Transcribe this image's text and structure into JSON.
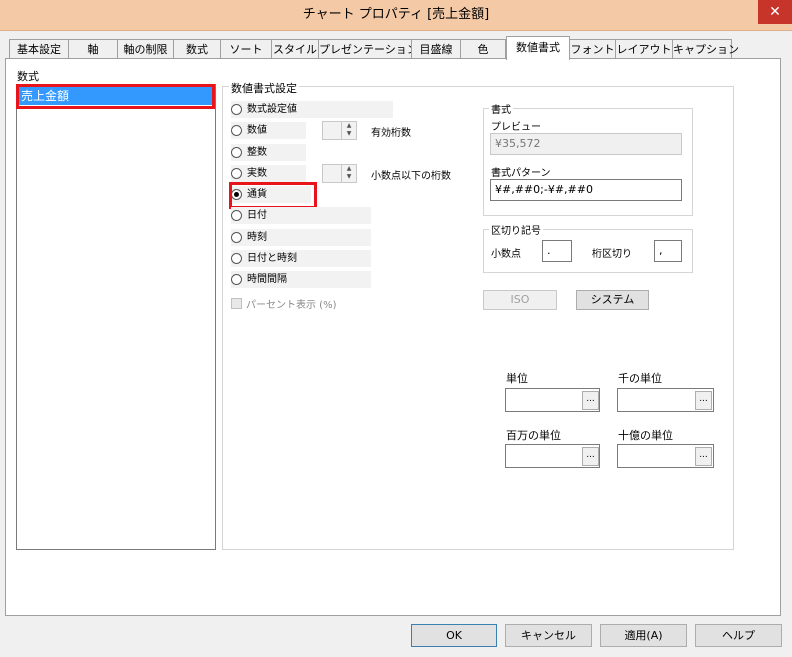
{
  "window": {
    "title": "チャート プロパティ [売上金額]",
    "close_glyph": "✕"
  },
  "tabs": [
    "基本設定",
    "軸",
    "軸の制限",
    "数式",
    "ソート",
    "スタイル",
    "プレゼンテーション",
    "目盛線",
    "色",
    "数値書式",
    "フォント",
    "レイアウト",
    "キャプション"
  ],
  "active_tab": "数値書式",
  "left": {
    "label": "数式",
    "items": [
      "売上金額"
    ]
  },
  "number_format": {
    "group_title": "数値書式設定",
    "options": [
      "数式設定値",
      "数値",
      "整数",
      "実数",
      "通貨",
      "日付",
      "時刻",
      "日付と時刻",
      "時間間隔"
    ],
    "selected": "通貨",
    "significant_digits_label": "有効桁数",
    "decimal_places_label": "小数点以下の桁数",
    "percent_label": "パーセント表示 (%)",
    "spin_up": "▲",
    "spin_down": "▼"
  },
  "format": {
    "group_title": "書式",
    "preview_label": "プレビュー",
    "preview_value": "¥35,572",
    "pattern_label": "書式パターン",
    "pattern_value": "¥#,##0;-¥#,##0"
  },
  "separators": {
    "group_title": "区切り記号",
    "decimal_label": "小数点",
    "decimal_value": ".",
    "thousands_label": "桁区切り",
    "thousands_value": ","
  },
  "buttons_mid": {
    "iso": "ISO",
    "system": "システム"
  },
  "units": {
    "unit_label": "単位",
    "thousand_label": "千の単位",
    "million_label": "百万の単位",
    "billion_label": "十億の単位",
    "browse_glyph": "..."
  },
  "footer": {
    "ok": "OK",
    "cancel": "キャンセル",
    "apply": "適用(A)",
    "help": "ヘルプ"
  }
}
